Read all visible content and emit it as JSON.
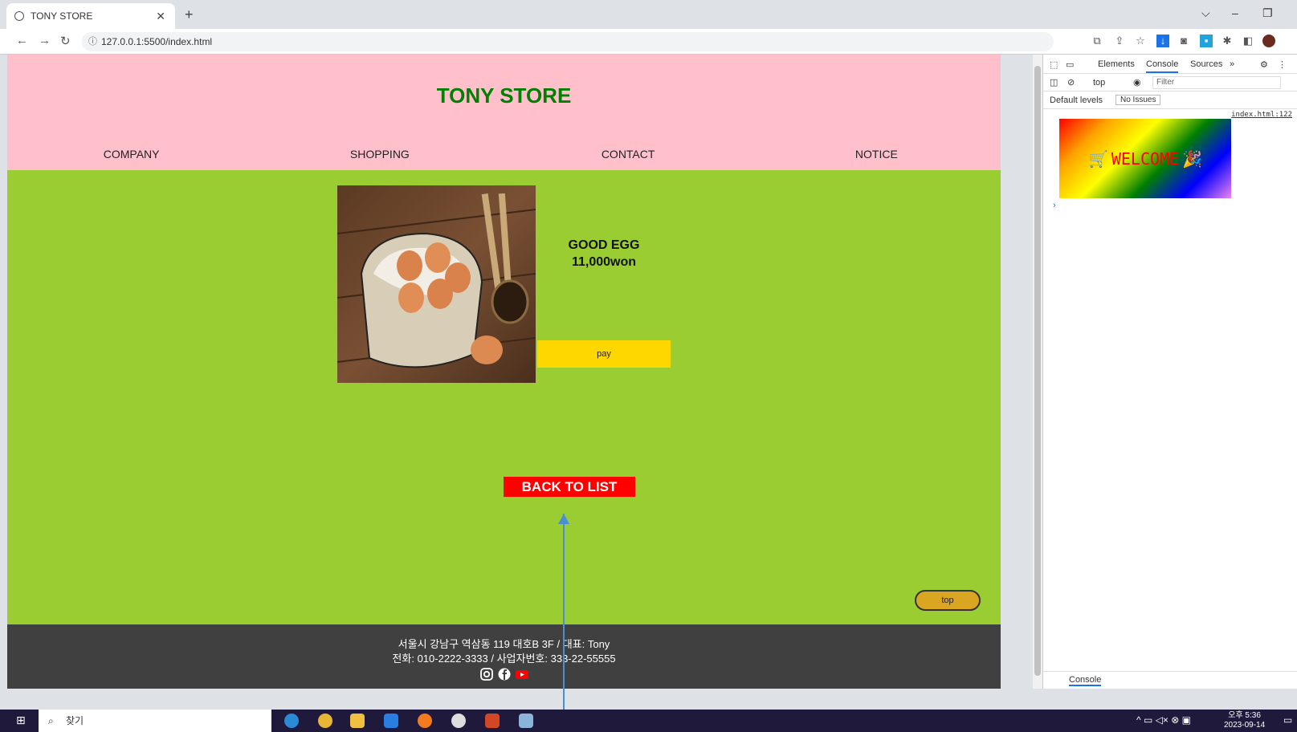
{
  "browser": {
    "tab_title": "TONY STORE",
    "url": "127.0.0.1:5500/index.html"
  },
  "site": {
    "title": "TONY STORE",
    "menu": [
      "COMPANY",
      "SHOPPING",
      "CONTACT",
      "NOTICE"
    ]
  },
  "product": {
    "name": "GOOD EGG",
    "price": "11,000won",
    "pay_label": "pay"
  },
  "actions": {
    "back_label": "BACK TO LIST",
    "top_label": "top"
  },
  "footer": {
    "address": "서울시 강남구 역삼동 119 대호B 3F / 대표: Tony",
    "contact": "전화: 010-2222-3333 / 사업자번호: 333-22-55555"
  },
  "devtools": {
    "tabs": [
      "Elements",
      "Console",
      "Sources"
    ],
    "active_tab": "Console",
    "context": "top",
    "filter_placeholder": "Filter",
    "levels": "Default levels",
    "issues": "No Issues",
    "source_link": "index.html:122",
    "welcome_text": "WELCOME",
    "drawer_tab": "Console"
  },
  "taskbar": {
    "search_label": "찾기",
    "time": "오후 5:36",
    "date": "2023-09-14"
  }
}
